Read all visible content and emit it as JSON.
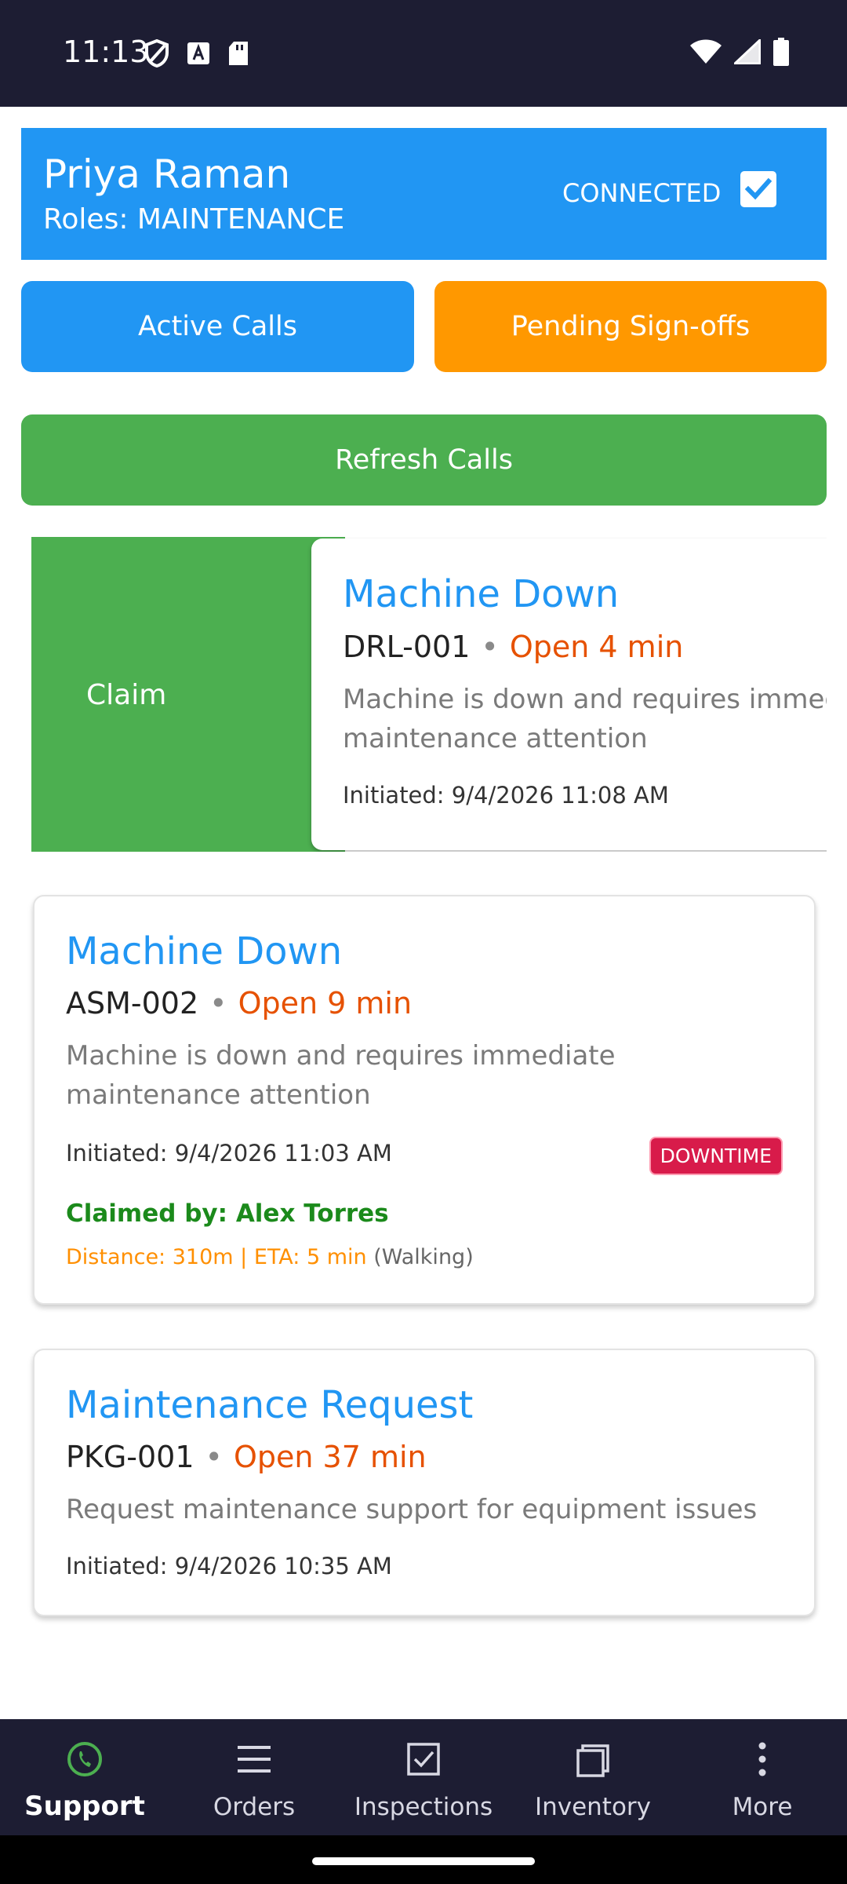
{
  "status_bar": {
    "time": "11:13"
  },
  "header": {
    "user_name": "Priya Raman",
    "roles": "Roles: MAINTENANCE",
    "connection_status": "CONNECTED"
  },
  "actions": {
    "active_calls": "Active Calls",
    "pending_signoffs": "Pending Sign-offs",
    "refresh_calls": "Refresh Calls"
  },
  "calls": [
    {
      "swipe_action": "Claim",
      "title": "Machine Down",
      "machine": "DRL-001",
      "separator": "•",
      "open": "Open 4 min",
      "description": "Machine is down and requires immediate maintenance attention",
      "initiated": "Initiated: 9/4/2026 11:08 AM"
    },
    {
      "title": "Machine Down",
      "machine": "ASM-002",
      "separator": "•",
      "open": "Open 9 min",
      "description": "Machine is down and requires immediate maintenance attention",
      "initiated": "Initiated: 9/4/2026 11:03 AM",
      "badge": "DOWNTIME",
      "claimed_by": "Claimed by: Alex Torres",
      "distance": "Distance: 310m | ETA: 5 min",
      "mode": "(Walking)"
    },
    {
      "title": "Maintenance Request",
      "machine": "PKG-001",
      "separator": "•",
      "open": "Open 37 min",
      "description": "Request maintenance support for equipment issues",
      "initiated": "Initiated: 9/4/2026 10:35 AM"
    }
  ],
  "bottom_nav": [
    {
      "label": "Support",
      "icon": "phone-icon",
      "active": true
    },
    {
      "label": "Orders",
      "icon": "menu-lines-icon"
    },
    {
      "label": "Inspections",
      "icon": "checkbox-icon"
    },
    {
      "label": "Inventory",
      "icon": "stack-icon"
    },
    {
      "label": "More",
      "icon": "more-vertical-icon"
    }
  ],
  "colors": {
    "primary_blue": "#2196f3",
    "orange": "#ff9800",
    "green": "#4caf50",
    "open_red": "#e65100",
    "downtime_badge": "#d81b4a",
    "nav_bg": "#1d1d33"
  }
}
